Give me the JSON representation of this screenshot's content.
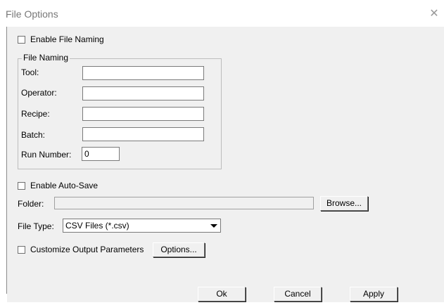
{
  "window": {
    "title": "File Options",
    "close_glyph": "✕"
  },
  "enable_file_naming": {
    "label": "Enable File Naming",
    "checked": false
  },
  "file_naming": {
    "legend": "File Naming",
    "tool": {
      "label": "Tool:",
      "value": ""
    },
    "operator": {
      "label": "Operator:",
      "value": ""
    },
    "recipe": {
      "label": "Recipe:",
      "value": ""
    },
    "batch": {
      "label": "Batch:",
      "value": ""
    },
    "run_number": {
      "label": "Run Number:",
      "value": "0"
    }
  },
  "enable_auto_save": {
    "label": "Enable Auto-Save",
    "checked": false
  },
  "folder": {
    "label": "Folder:",
    "value": "",
    "browse_label": "Browse..."
  },
  "file_type": {
    "label": "File Type:",
    "value": "CSV Files (*.csv)"
  },
  "customize_output": {
    "label": "Customize Output Parameters",
    "checked": false,
    "options_label": "Options..."
  },
  "buttons": {
    "ok": "Ok",
    "cancel": "Cancel",
    "apply": "Apply"
  }
}
